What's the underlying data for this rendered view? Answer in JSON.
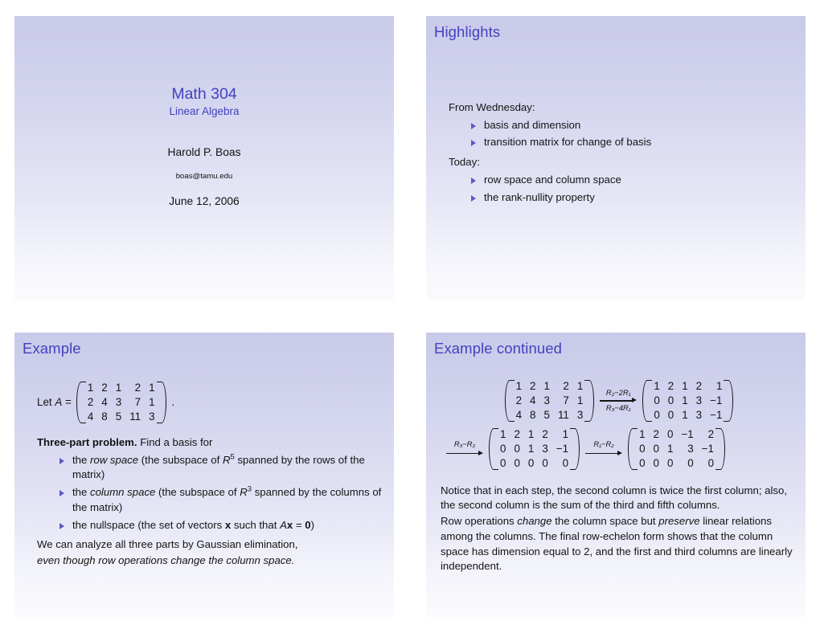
{
  "slides": {
    "title": {
      "name": "Math 304 title slide",
      "main_title": "Math 304",
      "subtitle": "Linear Algebra",
      "author": "Harold P. Boas",
      "email": "boas@tamu.edu",
      "date": "June 12, 2006"
    },
    "highlights": {
      "heading": "Highlights",
      "lead_1": "From Wednesday:",
      "bullets_1": [
        "basis and dimension",
        "transition matrix for change of basis"
      ],
      "lead_2": "Today:",
      "bullets_2": [
        "row space and column space",
        "the rank-nullity property"
      ]
    },
    "example": {
      "heading": "Example",
      "let_label": "Let A =",
      "matrix_A": [
        [
          "1",
          "2",
          "1",
          "2",
          "1"
        ],
        [
          "2",
          "4",
          "3",
          "7",
          "1"
        ],
        [
          "4",
          "8",
          "5",
          "11",
          "3"
        ]
      ],
      "period": ".",
      "problem_bold": "Three-part problem.",
      "problem_rest": " Find a basis for",
      "bullet_1_pre": "the ",
      "bullet_1_em": "row space",
      "bullet_1_mid": " (the subspace of ",
      "bullet_1_sym": "R",
      "bullet_1_sup": "5",
      "bullet_1_post": " spanned by the rows of the matrix)",
      "bullet_2_pre": "the ",
      "bullet_2_em": "column space",
      "bullet_2_mid": " (the subspace of ",
      "bullet_2_sym": "R",
      "bullet_2_sup": "3",
      "bullet_2_post": " spanned by the columns of the matrix)",
      "bullet_3_pre": "the nullspace (the set of vectors ",
      "bullet_3_x": "x",
      "bullet_3_mid": " such that ",
      "bullet_3_A": "A",
      "bullet_3_x2": "x",
      "bullet_3_eq": " = ",
      "bullet_3_zero": "0",
      "bullet_3_post": ")",
      "closing_1": "We can analyze all three parts by Gaussian elimination,",
      "closing_2": "even though row operations change the column space."
    },
    "example_continued": {
      "heading": "Example continued",
      "steps": {
        "m0": [
          [
            "1",
            "2",
            "1",
            "2",
            "1"
          ],
          [
            "2",
            "4",
            "3",
            "7",
            "1"
          ],
          [
            "4",
            "8",
            "5",
            "11",
            "3"
          ]
        ],
        "op1_top": "R₂−2R₁",
        "op1_bottom": "R₃−4R₁",
        "m1": [
          [
            "1",
            "2",
            "1",
            "2",
            "1"
          ],
          [
            "0",
            "0",
            "1",
            "3",
            "−1"
          ],
          [
            "0",
            "0",
            "1",
            "3",
            "−1"
          ]
        ],
        "op2": "R₃−R₂",
        "m2": [
          [
            "1",
            "2",
            "1",
            "2",
            "1"
          ],
          [
            "0",
            "0",
            "1",
            "3",
            "−1"
          ],
          [
            "0",
            "0",
            "0",
            "0",
            "0"
          ]
        ],
        "op3": "R₁−R₂",
        "m3": [
          [
            "1",
            "2",
            "0",
            "−1",
            "2"
          ],
          [
            "0",
            "0",
            "1",
            "3",
            "−1"
          ],
          [
            "0",
            "0",
            "0",
            "0",
            "0"
          ]
        ]
      },
      "para_1": "Notice that in each step, the second column is twice the first column; also, the second column is the sum of the third and fifth columns.",
      "para_2_a": "Row operations ",
      "para_2_em1": "change",
      "para_2_b": " the column space but ",
      "para_2_em2": "preserve",
      "para_2_c": " linear relations among the columns. The final row-echelon form shows that the column space has dimension equal to 2, and the first and third columns are linearly independent."
    }
  },
  "colors": {
    "heading": "#4341bf",
    "bullet": "#5b5ac8",
    "slide_top": "#c9cae9",
    "slide_bottom": "#fbfbfe",
    "text": "#141414"
  }
}
